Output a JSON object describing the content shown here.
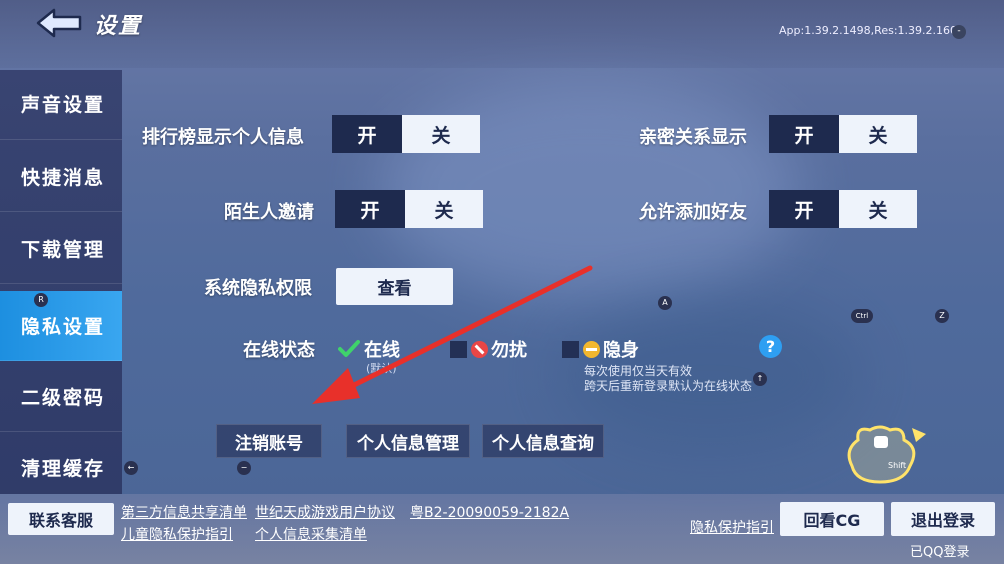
{
  "header": {
    "title": "设置",
    "version": "App:1.39.2.1498,Res:1.39.2.160",
    "version_badge": "-"
  },
  "sidebar": {
    "items": [
      {
        "label": "声音设置"
      },
      {
        "label": "快捷消息"
      },
      {
        "label": "下载管理"
      },
      {
        "label": "隐私设置"
      },
      {
        "label": "二级密码"
      },
      {
        "label": "清理缓存"
      }
    ],
    "key_hint": "R"
  },
  "privacy": {
    "rank_label": "排行榜显示个人信息",
    "intimacy_label": "亲密关系显示",
    "stranger_label": "陌生人邀请",
    "friend_label": "允许添加好友",
    "on_label": "开",
    "off_label": "关",
    "system_perm_label": "系统隐私权限",
    "view_button": "查看",
    "online_status_label": "在线状态",
    "status_online": "在线",
    "status_default": "(默认)",
    "status_dnd": "勿扰",
    "status_invisible": "隐身",
    "note_line1": "每次使用仅当天有效",
    "note_line2": "跨天后重新登录默认为在线状态",
    "help_glyph": "?",
    "cancel_account": "注销账号",
    "info_manage": "个人信息管理",
    "info_query": "个人信息查询"
  },
  "key_hints": {
    "a": "A",
    "ctrl": "Ctrl",
    "z": "Z",
    "up": "↑",
    "left": "←",
    "minus": "−",
    "shift": "Shift"
  },
  "footer": {
    "contact": "联系客服",
    "link_third_party": "第三方信息共享清单",
    "link_user_agreement": "世纪天成游戏用户协议",
    "link_license": "粤B2-20090059-2182A",
    "link_child_privacy": "儿童隐私保护指引",
    "link_info_collection": "个人信息采集清单",
    "link_privacy": "隐私保护指引",
    "replay_cg": "回看CG",
    "logout": "退出登录",
    "login_state": "已QQ登录"
  },
  "colors": {
    "accent": "#2e9ff2",
    "dark_toggle": "#1e2a4e",
    "light_toggle": "#eef3fb",
    "arrow": "#e8302a"
  }
}
